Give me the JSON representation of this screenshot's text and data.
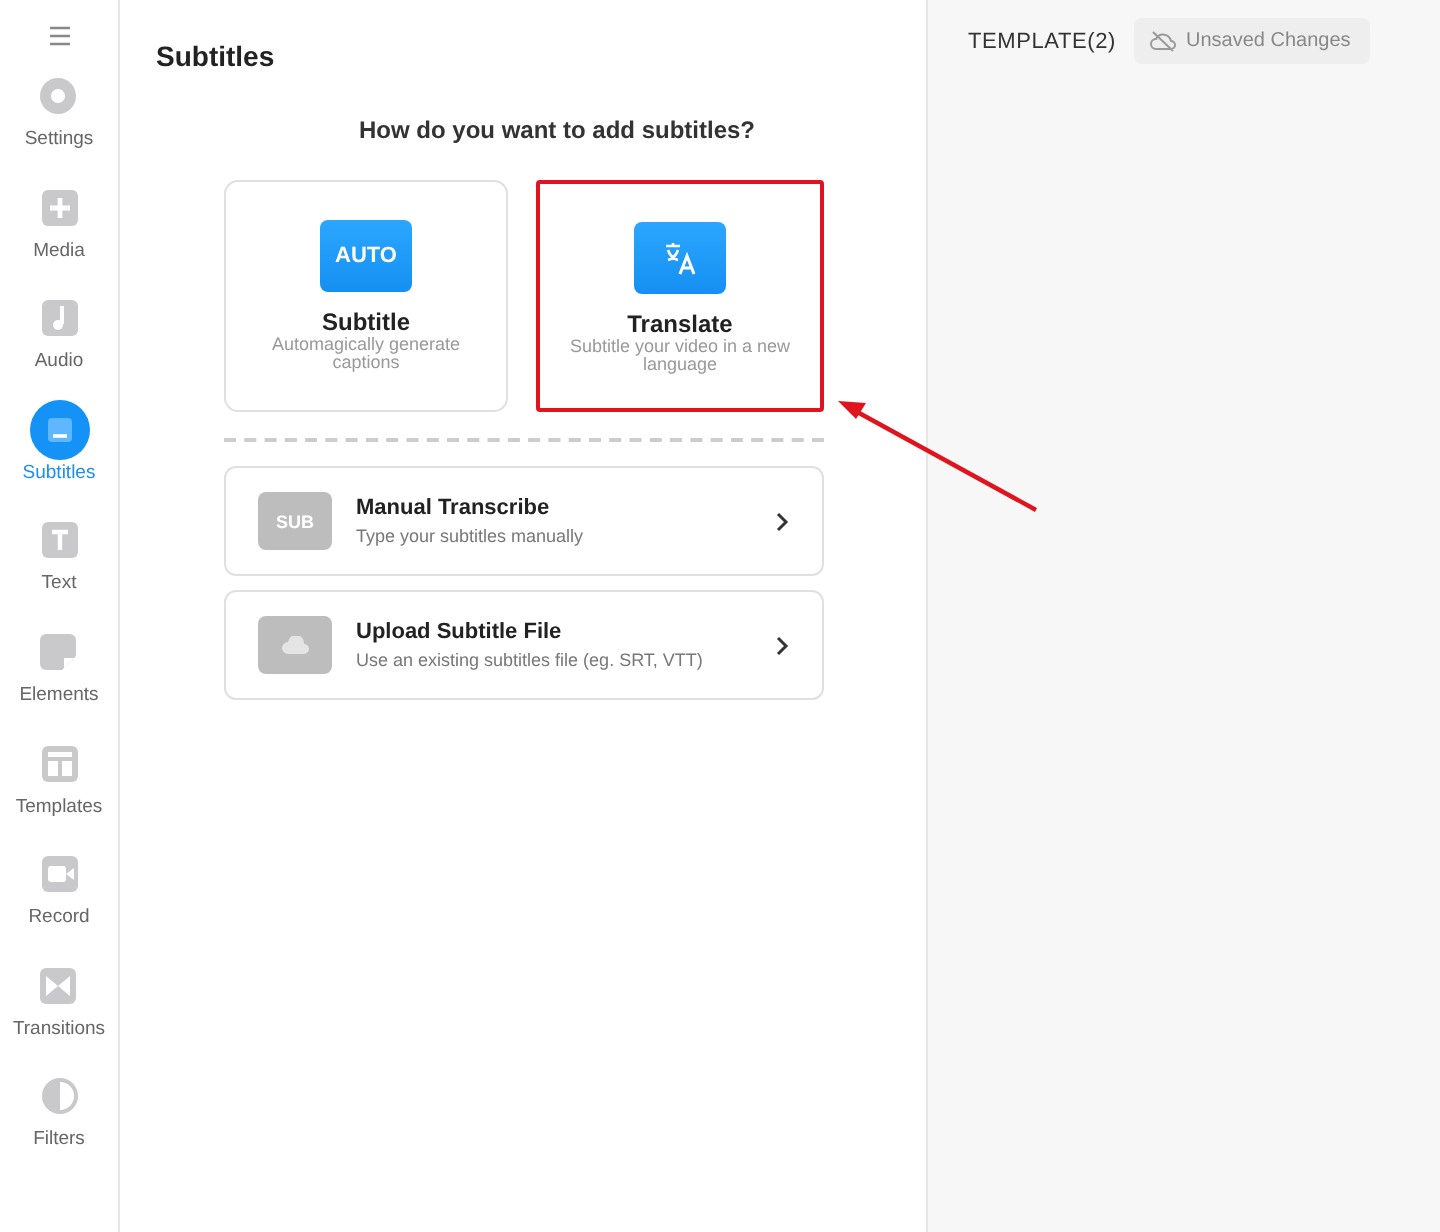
{
  "sidebar": {
    "items": [
      {
        "label": "Settings",
        "kind": "settings",
        "selected": false
      },
      {
        "label": "Media",
        "kind": "media",
        "selected": false
      },
      {
        "label": "Audio",
        "kind": "audio",
        "selected": false
      },
      {
        "label": "Subtitles",
        "kind": "subtitles",
        "selected": true
      },
      {
        "label": "Text",
        "kind": "text",
        "selected": false
      },
      {
        "label": "Elements",
        "kind": "elements",
        "selected": false
      },
      {
        "label": "Templates",
        "kind": "templates",
        "selected": false
      },
      {
        "label": "Record",
        "kind": "record",
        "selected": false
      },
      {
        "label": "Transitions",
        "kind": "transitions",
        "selected": false
      },
      {
        "label": "Filters",
        "kind": "filters",
        "selected": false
      }
    ]
  },
  "panel": {
    "title": "Subtitles",
    "question": "How do you want to add subtitles?",
    "options": [
      {
        "kind": "auto",
        "badge": "AUTO",
        "title": "Subtitle",
        "description": "Automagically generate captions",
        "highlighted": false
      },
      {
        "kind": "translate",
        "title": "Translate",
        "description": "Subtitle your video in a new language",
        "highlighted": true
      }
    ],
    "rows": [
      {
        "kind": "sub",
        "badge": "SUB",
        "title": "Manual Transcribe",
        "description": "Type your subtitles manually"
      },
      {
        "kind": "upload",
        "title": "Upload Subtitle File",
        "description": "Use an existing subtitles file (eg. SRT, VTT)"
      }
    ]
  },
  "header": {
    "template": "TEMPLATE(2)",
    "status": "Unsaved Changes"
  }
}
